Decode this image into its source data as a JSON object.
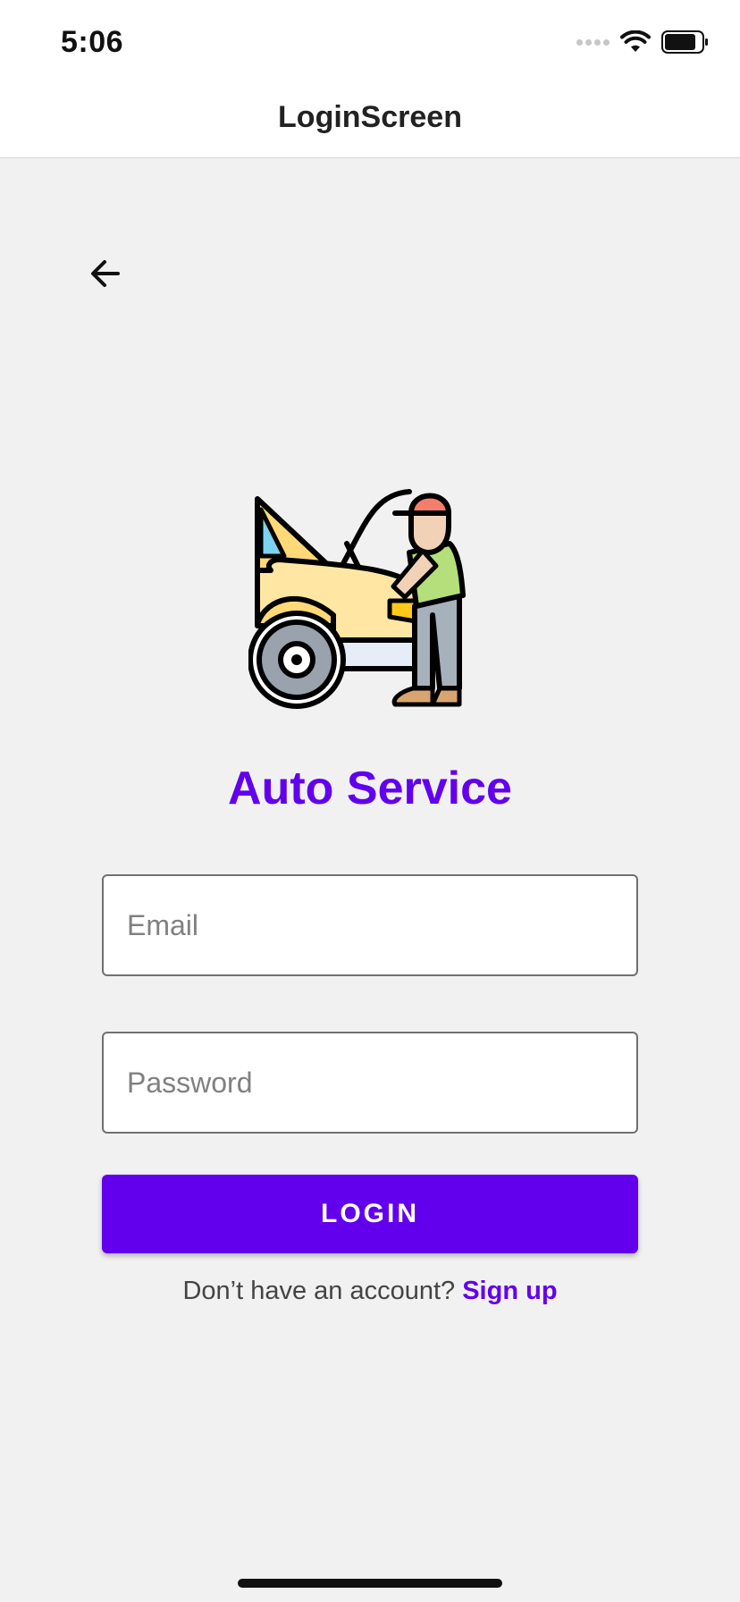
{
  "status_bar": {
    "time": "5:06",
    "icons": [
      "signal-icon",
      "wifi-icon",
      "battery-icon"
    ]
  },
  "nav": {
    "title": "LoginScreen",
    "back_icon": "arrow-left-icon"
  },
  "logo": {
    "icon": "mechanic-car-icon"
  },
  "app": {
    "title": "Auto Service"
  },
  "form": {
    "email_placeholder": "Email",
    "email_value": "",
    "password_placeholder": "Password",
    "password_value": "",
    "login_label": "LOGIN"
  },
  "signup": {
    "prompt": "Don’t have an account?",
    "link_label": "Sign up"
  },
  "colors": {
    "accent": "#6200ee",
    "background": "#f1f1f1",
    "header": "#ffffff"
  }
}
